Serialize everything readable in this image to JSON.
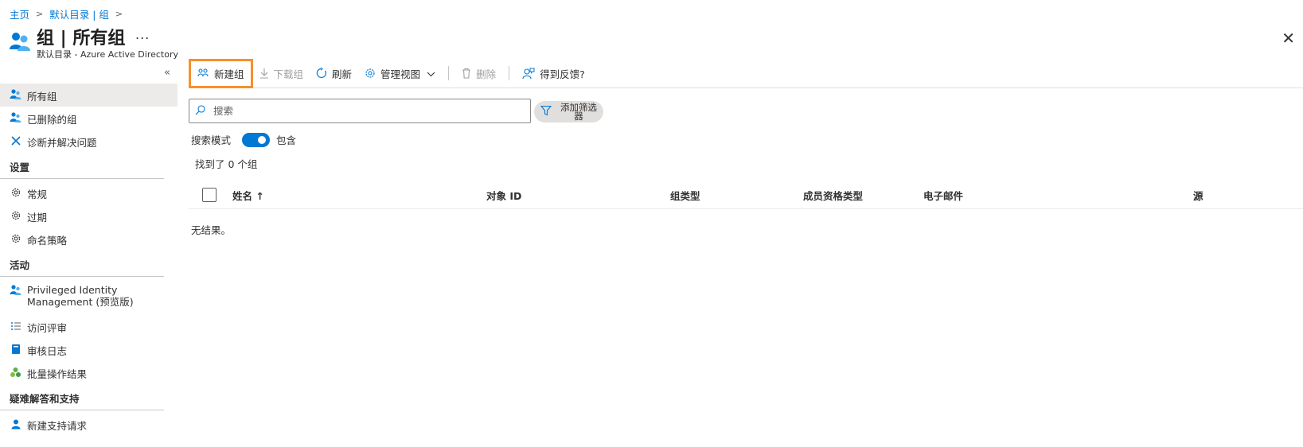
{
  "breadcrumb": {
    "home": "主页",
    "directory": "默认目录 | 组"
  },
  "header": {
    "title": "组 | 所有组",
    "more": "...",
    "subtitle": "默认目录 - Azure Active Directory",
    "close": "✕"
  },
  "sidebar": {
    "collapse": "«",
    "items_top": [
      {
        "label": "所有组"
      },
      {
        "label": "已删除的组"
      },
      {
        "label": "诊断并解决问题"
      }
    ],
    "settings_heading": "设置",
    "settings_items": [
      {
        "label": "常规"
      },
      {
        "label": "过期"
      },
      {
        "label": "命名策略"
      }
    ],
    "activity_heading": "活动",
    "activity_items": [
      {
        "label": "Privileged Identity Management (预览版)"
      },
      {
        "label": "访问评审"
      },
      {
        "label": "审核日志"
      },
      {
        "label": "批量操作结果"
      }
    ],
    "support_heading": "疑难解答和支持",
    "support_items": [
      {
        "label": "新建支持请求"
      }
    ]
  },
  "toolbar": {
    "new_group": "新建组",
    "download_groups": "下载组",
    "refresh": "刷新",
    "manage_view": "管理视图",
    "delete": "删除",
    "feedback": "得到反馈?"
  },
  "search": {
    "placeholder": "搜索"
  },
  "filter": {
    "label": "添加筛选器"
  },
  "search_mode": {
    "label": "搜索模式",
    "value": "包含",
    "enabled": true
  },
  "results": {
    "found_text": "找到了 0 个组",
    "empty_text": "无结果。"
  },
  "table": {
    "columns": [
      "姓名 ↑",
      "对象 ID",
      "组类型",
      "成员资格类型",
      "电子邮件",
      "源"
    ]
  },
  "colors": {
    "accent": "#0078d4",
    "highlight": "#f7902b"
  }
}
